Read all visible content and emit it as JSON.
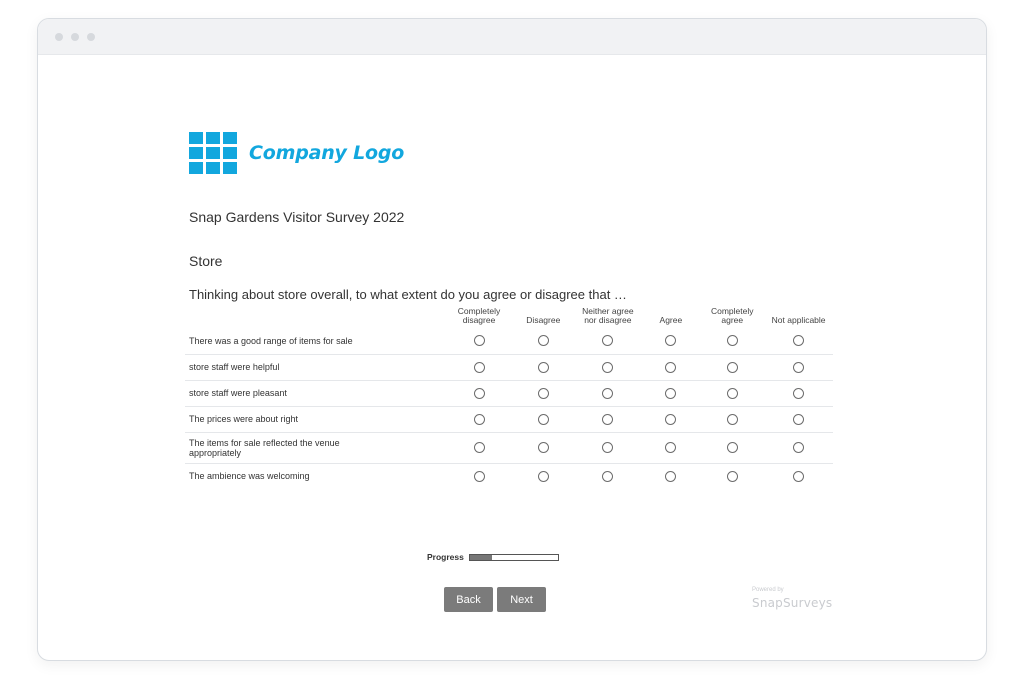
{
  "logo": {
    "text": "Company Logo"
  },
  "survey": {
    "title": "Snap Gardens Visitor Survey 2022",
    "section": "Store",
    "question": "Thinking about store overall, to what extent do you agree or disagree that …"
  },
  "scale": [
    {
      "line1": "Completely",
      "line2": "disagree"
    },
    {
      "line1": "Disagree",
      "line2": ""
    },
    {
      "line1": "Neither agree",
      "line2": "nor disagree"
    },
    {
      "line1": "Agree",
      "line2": ""
    },
    {
      "line1": "Completely",
      "line2": "agree"
    },
    {
      "line1": "Not applicable",
      "line2": ""
    }
  ],
  "statements": [
    "There was a good range of items for sale",
    "store staff were helpful",
    "store staff were pleasant",
    "The prices were about right",
    "The items for sale reflected the venue appropriately",
    "The ambience was welcoming"
  ],
  "progress": {
    "label": "Progress",
    "percent": 25
  },
  "buttons": {
    "back": "Back",
    "next": "Next"
  },
  "powered": {
    "by": "Powered by",
    "brand": "SnapSurveys"
  },
  "colors": {
    "brand": "#12a7de",
    "button": "#7b7b7b"
  }
}
